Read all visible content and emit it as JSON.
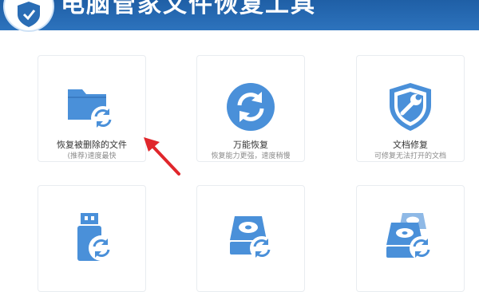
{
  "app": {
    "title": "电脑管家文件恢复工具"
  },
  "colors": {
    "header": "#2a6db5",
    "icon": "#4a90d9",
    "arrow": "#e0262b"
  },
  "cards": [
    {
      "icon": "folder-recover-icon",
      "title": "恢复被删除的文件",
      "subtitle": "(推荐)速度最快"
    },
    {
      "icon": "sync-circle-icon",
      "title": "万能恢复",
      "subtitle": "恢复能力更强，速度稍慢"
    },
    {
      "icon": "shield-wrench-icon",
      "title": "文档修复",
      "subtitle": "可修复无法打开的文档"
    },
    {
      "icon": "usb-drive-recover-icon",
      "title": "",
      "subtitle": ""
    },
    {
      "icon": "hard-disk-recover-icon",
      "title": "",
      "subtitle": ""
    },
    {
      "icon": "multi-disk-recover-icon",
      "title": "",
      "subtitle": ""
    }
  ]
}
